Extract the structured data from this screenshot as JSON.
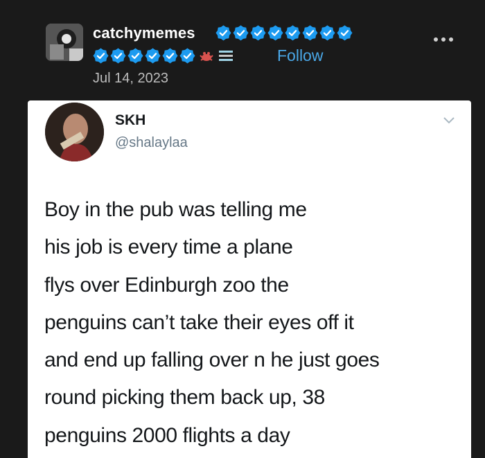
{
  "post": {
    "username": "catchymemes",
    "follow_label": "Follow",
    "date": "Jul 14, 2023",
    "badge_color": "#1d9bf0",
    "badges_row1": 8,
    "badges_row2": 6,
    "icons": [
      "avatar-photo",
      "verified-badge-icon",
      "crab-icon",
      "bookshelf-icon",
      "more-options-icon"
    ]
  },
  "tweet": {
    "display_name": "SKH",
    "handle": "@shalaylaa",
    "lines": [
      "Boy in the pub was telling me",
      "his job is  every time a plane",
      "flys over Edinburgh zoo the",
      "penguins can’t take their eyes off it",
      "and end up falling over n he just goes",
      "round picking them back up, 38",
      "penguins 2000 flights a day"
    ]
  }
}
